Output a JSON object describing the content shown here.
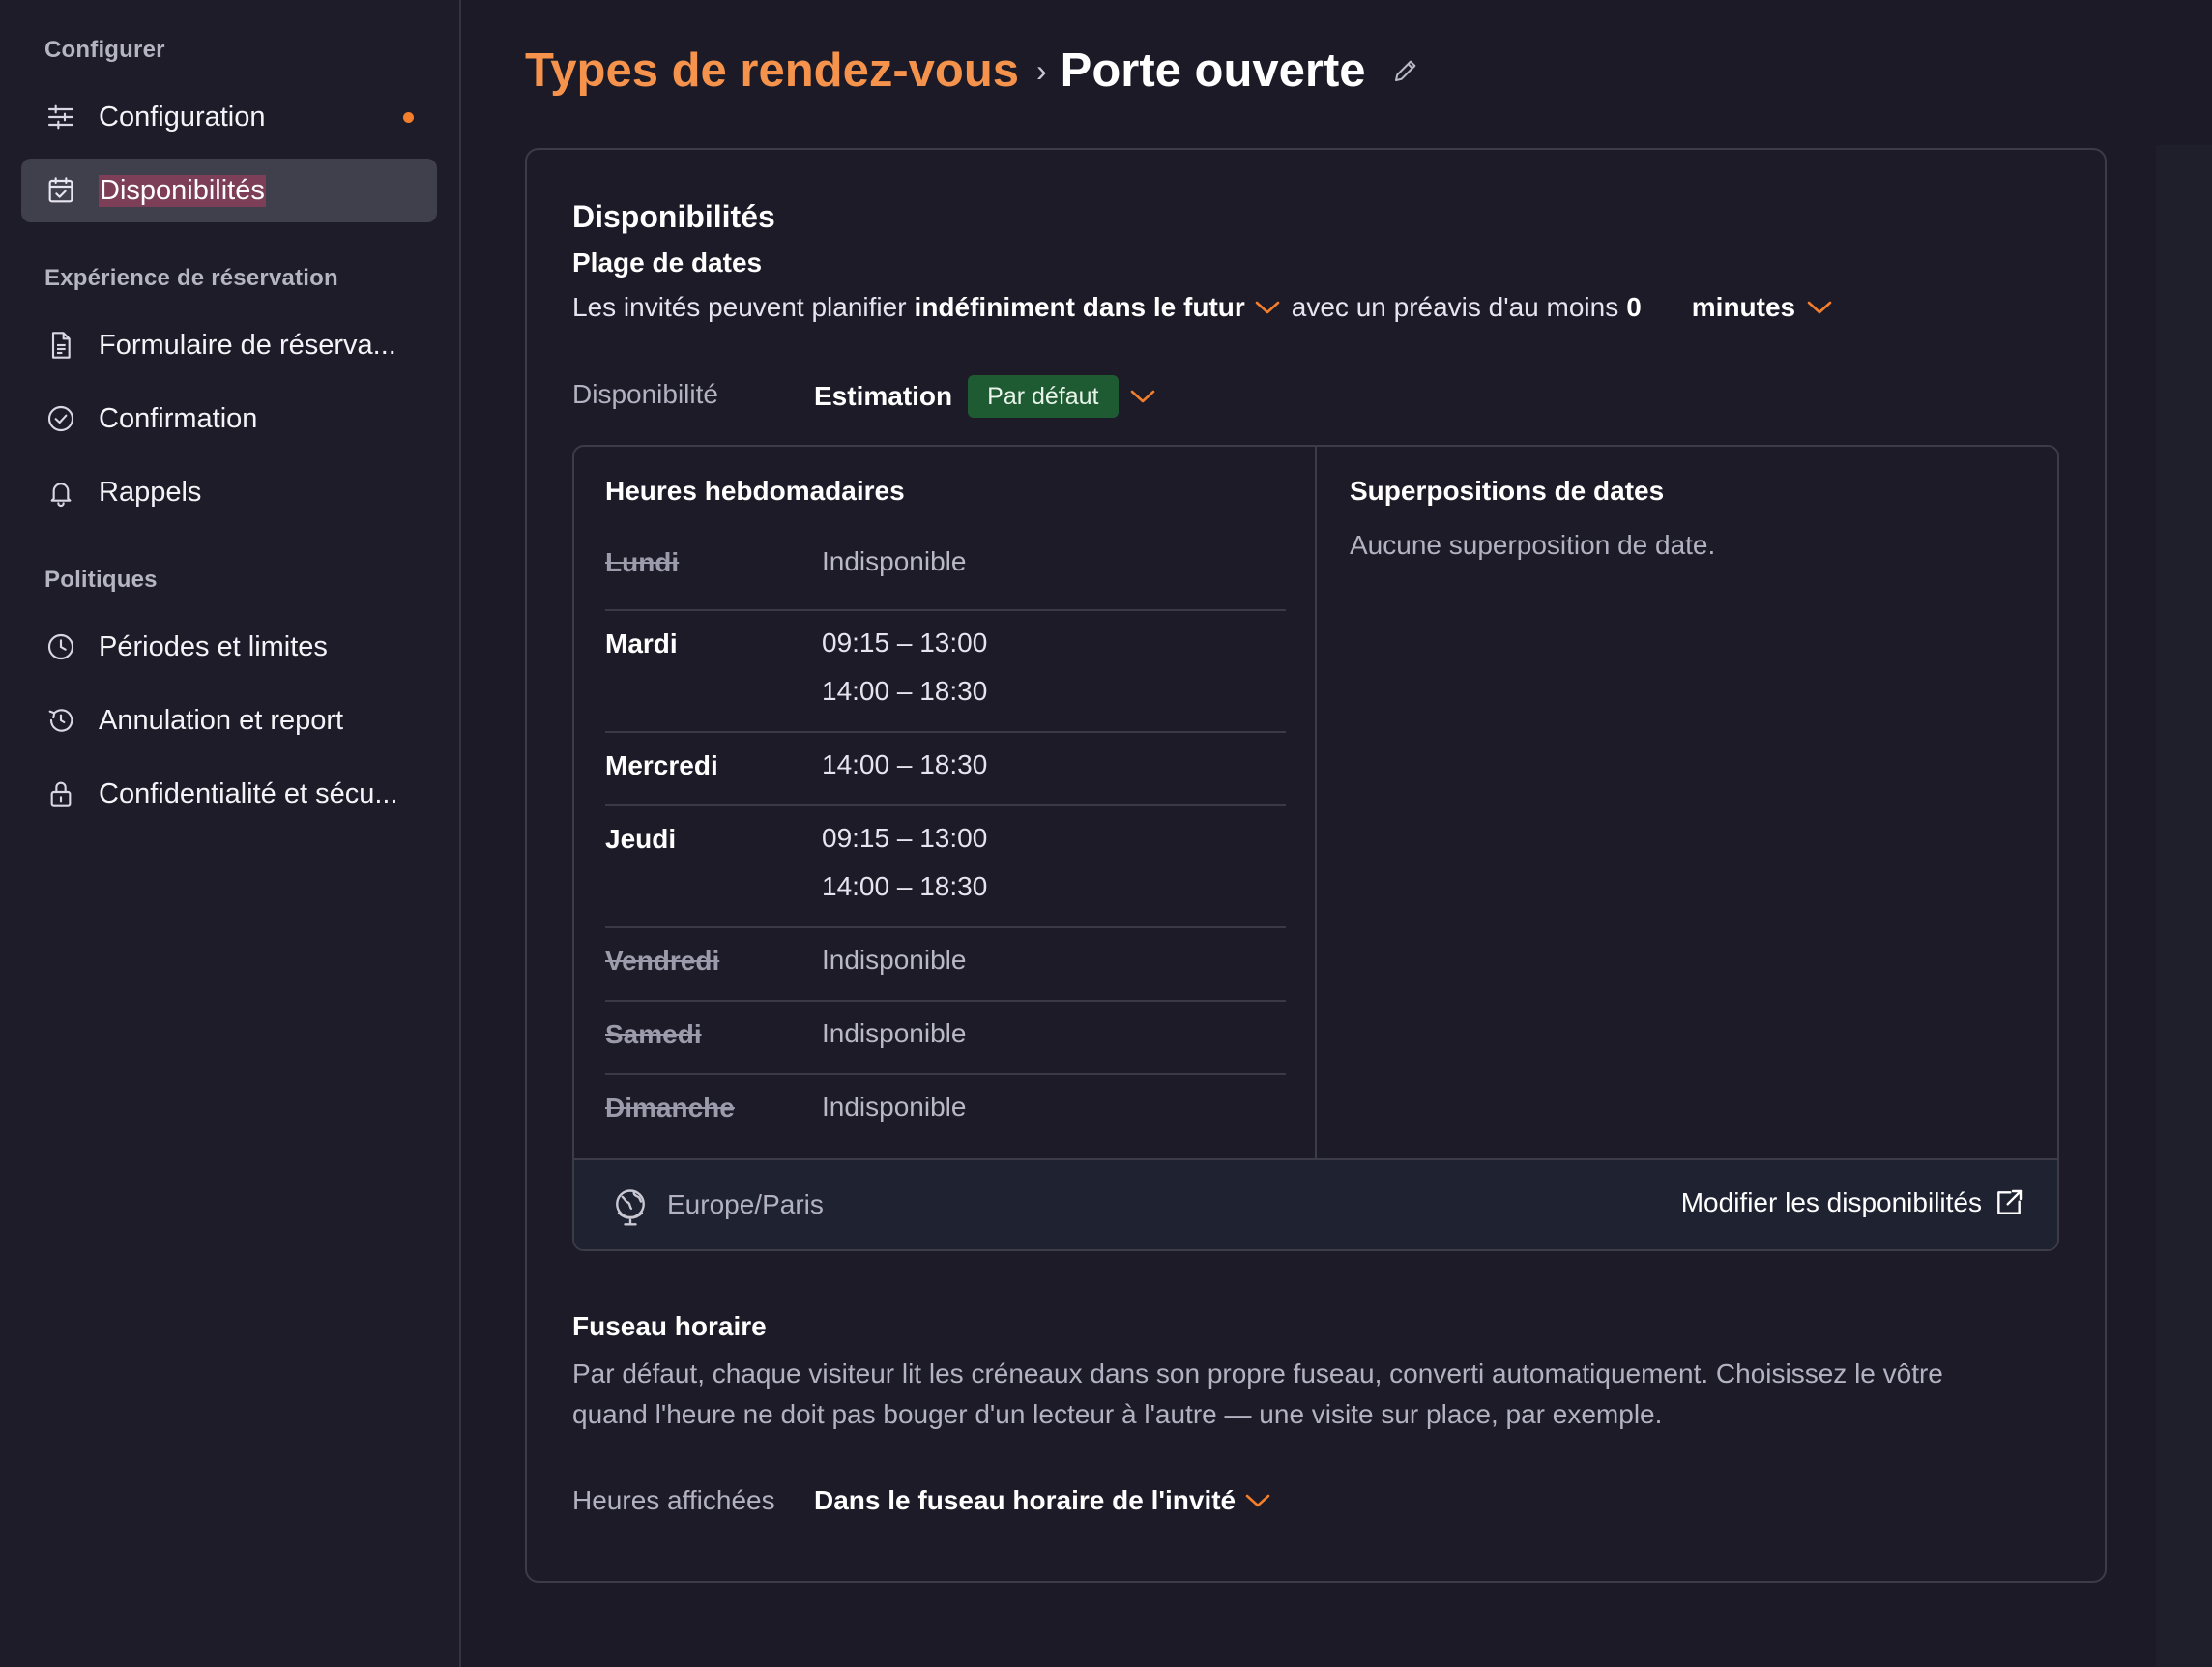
{
  "sidebar": {
    "sections": [
      {
        "title": "Configurer"
      },
      {
        "title": "Expérience de réservation"
      },
      {
        "title": "Politiques"
      }
    ],
    "items": [
      {
        "label": "Configuration",
        "icon": "sliders-icon"
      },
      {
        "label": "Disponibilités",
        "icon": "calendar-check-icon"
      },
      {
        "label": "Formulaire de réserva...",
        "icon": "document-icon"
      },
      {
        "label": "Confirmation",
        "icon": "check-circle-icon"
      },
      {
        "label": "Rappels",
        "icon": "bell-icon"
      },
      {
        "label": "Périodes et limites",
        "icon": "clock-icon"
      },
      {
        "label": "Annulation et report",
        "icon": "history-icon"
      },
      {
        "label": "Confidentialité et sécu...",
        "icon": "lock-icon"
      }
    ],
    "active_item": "Disponibilités"
  },
  "breadcrumb": {
    "parent": "Types de rendez-vous",
    "separator": "›",
    "current": "Porte ouverte"
  },
  "card": {
    "title": "Disponibilités",
    "date_range": {
      "heading": "Plage de dates",
      "prefix": "Les invités peuvent planifier",
      "horizon": "indéfiniment dans le futur",
      "middle": "avec un préavis d'au moins",
      "notice_value": "0",
      "notice_unit": "minutes"
    },
    "availability": {
      "label": "Disponibilité",
      "schedule_name": "Estimation",
      "badge": "Par défaut"
    },
    "weekly": {
      "heading": "Heures hebdomadaires",
      "days": [
        {
          "day": "Lundi",
          "available": false,
          "hours": [
            "Indisponible"
          ]
        },
        {
          "day": "Mardi",
          "available": true,
          "hours": [
            "09:15 – 13:00",
            "14:00 – 18:30"
          ]
        },
        {
          "day": "Mercredi",
          "available": true,
          "hours": [
            "14:00 – 18:30"
          ]
        },
        {
          "day": "Jeudi",
          "available": true,
          "hours": [
            "09:15 – 13:00",
            "14:00 – 18:30"
          ]
        },
        {
          "day": "Vendredi",
          "available": false,
          "hours": [
            "Indisponible"
          ]
        },
        {
          "day": "Samedi",
          "available": false,
          "hours": [
            "Indisponible"
          ]
        },
        {
          "day": "Dimanche",
          "available": false,
          "hours": [
            "Indisponible"
          ]
        }
      ]
    },
    "overrides": {
      "heading": "Superpositions de dates",
      "empty_text": "Aucune superposition de date."
    },
    "footer": {
      "timezone": "Europe/Paris",
      "edit_link": "Modifier les disponibilités"
    },
    "timezone_section": {
      "heading": "Fuseau horaire",
      "description_line1": "Par défaut, chaque visiteur lit les créneaux dans son propre fuseau, converti automatiquement. Choisissez le vôtre",
      "description_line2": "quand l'heure ne doit pas bouger d'un lecteur à l'autre — une visite sur place, par exemple.",
      "display_label": "Heures affichées",
      "display_value": "Dans le fuseau horaire de l'invité"
    }
  },
  "colors": {
    "accent": "#f37e2c",
    "breadcrumb_link": "#f5924c",
    "badge_bg": "#1e5b32",
    "active_item_bg": "#403f4c",
    "active_label_highlight": "#7c3f57",
    "background": "#1b1a26"
  }
}
